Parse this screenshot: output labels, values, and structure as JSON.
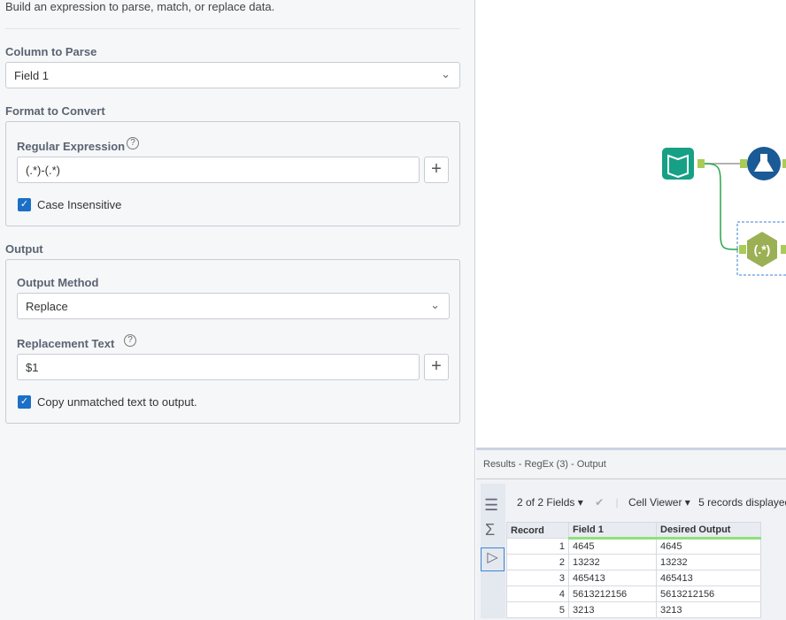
{
  "description": "Build an expression to parse, match, or replace data.",
  "column_to_parse": {
    "label": "Column to Parse",
    "value": "Field 1"
  },
  "format": {
    "label": "Format to Convert",
    "regex_label": "Regular Expression",
    "regex_value": "(.*)-(.*)",
    "case_insensitive": "Case Insensitive"
  },
  "output": {
    "label": "Output",
    "method_label": "Output Method",
    "method_value": "Replace",
    "replacement_label": "Replacement Text",
    "replacement_value": "$1",
    "copy_unmatched": "Copy unmatched text to output."
  },
  "results": {
    "title": "Results - RegEx (3) - Output",
    "fields": "2 of 2 Fields",
    "cell_viewer": "Cell Viewer",
    "records": "5 records displayed",
    "columns": [
      "Record",
      "Field 1",
      "Desired Output"
    ],
    "rows": [
      [
        "1",
        "4645",
        "4645"
      ],
      [
        "2",
        "13232",
        "13232"
      ],
      [
        "3",
        "465413",
        "465413"
      ],
      [
        "4",
        "5613212156",
        "5613212156"
      ],
      [
        "5",
        "3213",
        "3213"
      ]
    ]
  },
  "nodes": {
    "regex_label": "(.*)"
  }
}
